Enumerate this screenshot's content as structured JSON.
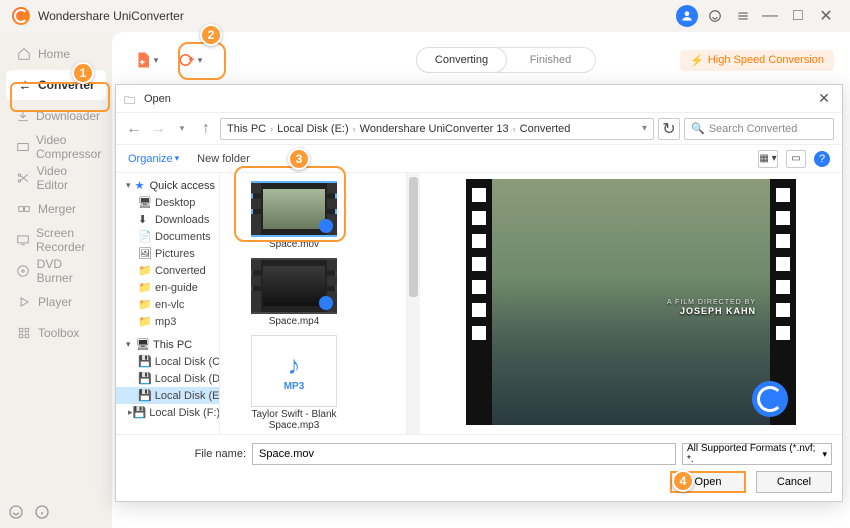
{
  "app": {
    "title": "Wondershare UniConverter"
  },
  "titlebar": {
    "minimize": "—",
    "maximize": "□",
    "close": "✕"
  },
  "sidebar": {
    "items": [
      {
        "label": "Home"
      },
      {
        "label": "Converter"
      },
      {
        "label": "Downloader"
      },
      {
        "label": "Video Compressor"
      },
      {
        "label": "Video Editor"
      },
      {
        "label": "Merger"
      },
      {
        "label": "Screen Recorder"
      },
      {
        "label": "DVD Burner"
      },
      {
        "label": "Player"
      },
      {
        "label": "Toolbox"
      }
    ]
  },
  "toolbar": {
    "tabs": {
      "converting": "Converting",
      "finished": "Finished"
    },
    "high_speed": "High Speed Conversion"
  },
  "dialog": {
    "title": "Open",
    "breadcrumb": [
      "This PC",
      "Local Disk (E:)",
      "Wondershare UniConverter 13",
      "Converted"
    ],
    "search_placeholder": "Search Converted",
    "organize": "Organize",
    "new_folder": "New folder",
    "tree": {
      "quick_access": "Quick access",
      "desktop": "Desktop",
      "downloads": "Downloads",
      "documents": "Documents",
      "pictures": "Pictures",
      "converted": "Converted",
      "en_guide": "en-guide",
      "en_vlc": "en-vlc",
      "mp3": "mp3",
      "this_pc": "This PC",
      "disk_c": "Local Disk (C:)",
      "disk_d": "Local Disk (D:)",
      "disk_e": "Local Disk (E:)",
      "disk_f": "Local Disk (F:)"
    },
    "files": {
      "f1": "Space.mov",
      "f2": "Space.mp4",
      "f3": "Taylor Swift - Blank Space.mp3",
      "mp3_tag": "MP3"
    },
    "preview": {
      "line1": "A FILM DIRECTED BY",
      "line2": "JOSEPH KAHN"
    },
    "filename_label": "File name:",
    "filename_value": "Space.mov",
    "format_label": "All Supported Formats (*.nvf; *.",
    "open_btn": "Open",
    "cancel_btn": "Cancel",
    "help": "?"
  },
  "annotations": {
    "n1": "1",
    "n2": "2",
    "n3": "3",
    "n4": "4"
  }
}
